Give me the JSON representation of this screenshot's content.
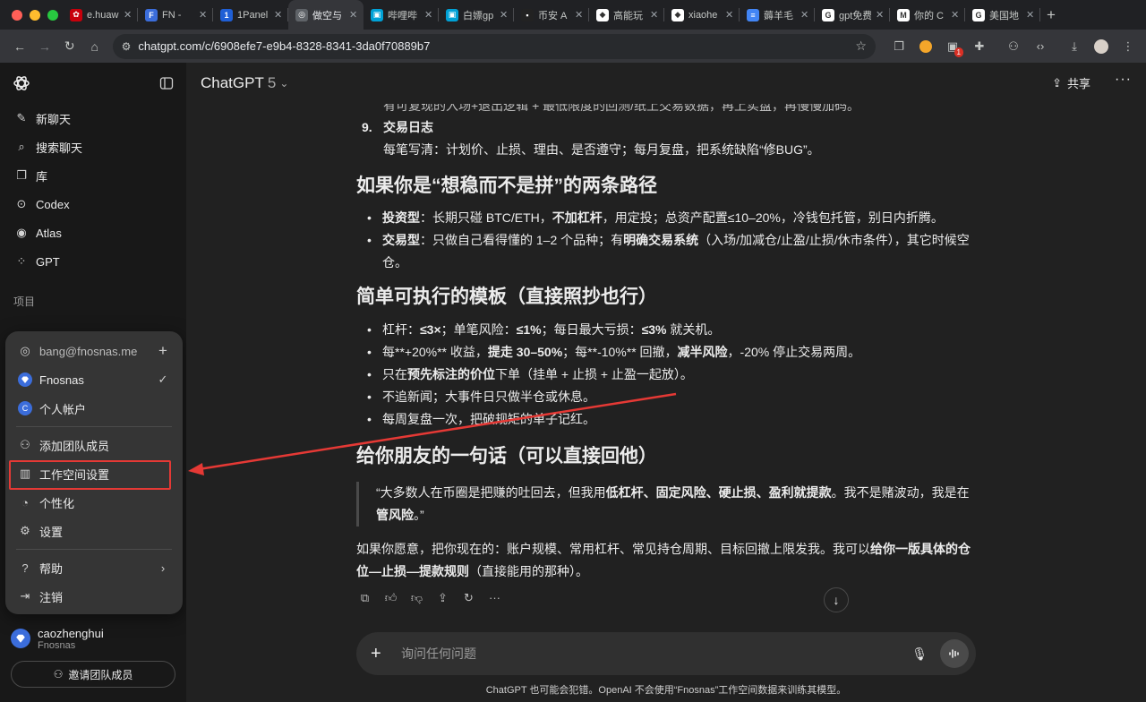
{
  "browser": {
    "traffic_colors": [
      "#ff5f57",
      "#febc2e",
      "#28c840"
    ],
    "tabs": [
      {
        "title": "e.huaw",
        "fav_color": "#c7000b",
        "fav_text": "✿"
      },
      {
        "title": "FN - ",
        "fav_color": "#3b6ddb",
        "fav_text": "F"
      },
      {
        "title": "1Panel",
        "fav_color": "#1f5fd6",
        "fav_text": "1"
      },
      {
        "title": "做空与",
        "fav_color": "#5f6368",
        "fav_text": "◎",
        "active": true
      },
      {
        "title": "哔哩哔",
        "fav_color": "#00a1d6",
        "fav_text": "▣"
      },
      {
        "title": "白嫖gp",
        "fav_color": "#00a1d6",
        "fav_text": "▣"
      },
      {
        "title": "币安 A",
        "fav_color": "#222",
        "fav_text": "▪"
      },
      {
        "title": "高能玩",
        "fav_color": "#fff",
        "fav_text": "◆"
      },
      {
        "title": "xiaohe",
        "fav_color": "#fff",
        "fav_text": "◆"
      },
      {
        "title": "薅羊毛",
        "fav_color": "#4285f4",
        "fav_text": "≡"
      },
      {
        "title": "gpt免费",
        "fav_color": "#fff",
        "fav_text": "G"
      },
      {
        "title": "你的 C",
        "fav_color": "#fff",
        "fav_text": "M"
      },
      {
        "title": "美国地",
        "fav_color": "#fff",
        "fav_text": "G"
      }
    ],
    "new_tab": "+",
    "url": "chatgpt.com/c/6908efe7-e9b4-8328-8341-3da0f70889b7",
    "ext_badge": "1"
  },
  "sidebar": {
    "items": [
      {
        "label": "新聊天",
        "icon": "edit-icon"
      },
      {
        "label": "搜索聊天",
        "icon": "search-icon"
      },
      {
        "label": "库",
        "icon": "library-icon"
      },
      {
        "label": "Codex",
        "icon": "codex-icon"
      },
      {
        "label": "Atlas",
        "icon": "compass-icon"
      },
      {
        "label": "GPT",
        "icon": "grid-icon"
      }
    ],
    "section_label": "项目",
    "user": {
      "name": "caozhenghui",
      "org": "Fnosnas"
    },
    "invite_label": "邀请团队成员"
  },
  "popup": {
    "email": "bang@fnosnas.me",
    "workspaces": [
      {
        "label": "Fnosnas",
        "selected": true
      },
      {
        "label": "个人帐户",
        "avatar": "C"
      }
    ],
    "menu1": [
      {
        "label": "添加团队成员",
        "icon": "add-user-icon"
      },
      {
        "label": "工作空间设置",
        "icon": "workspace-icon"
      },
      {
        "label": "个性化",
        "icon": "personalize-icon"
      },
      {
        "label": "设置",
        "icon": "gear-icon"
      }
    ],
    "menu2": [
      {
        "label": "帮助",
        "icon": "help-icon"
      },
      {
        "label": "注销",
        "icon": "logout-icon"
      }
    ]
  },
  "header": {
    "model_name": "ChatGPT",
    "model_version": "5",
    "share_label": "共享"
  },
  "conversation": {
    "clipped_line": "有可复现的入场+退出逻辑 + 最低限度的回测/纸上交易数据，再上实盘，再慢慢加码。",
    "item9": {
      "num": "9.",
      "title": "交易日志",
      "desc": "每笔写清：计划价、止损、理由、是否遵守；每月复盘，把系统缺陷“修BUG”。"
    },
    "h_paths": "如果你是“想稳而不是拼”的两条路径",
    "paths": [
      {
        "b": "投资型",
        "t1": "：长期只碰 BTC/ETH，",
        "b2": "不加杠杆",
        "t2": "，用定投；总资产配置≤10–20%，冷钱包托管，别日内折腾。"
      },
      {
        "b": "交易型",
        "t1": "：只做自己看得懂的 1–2 个品种；有",
        "b2": "明确交易系统",
        "t2": "（入场/加减仓/止盈/止损/休市条件），其它时候空仓。"
      }
    ],
    "h_template": "简单可执行的模板（直接照抄也行）",
    "template": {
      "l1": {
        "a": "杠杆：",
        "b": "≤3×",
        "c": "；单笔风险：",
        "d": "≤1%",
        "e": "；每日最大亏损：",
        "f": "≤3%",
        "g": " 就关机。"
      },
      "l2": {
        "a": "每**+20%** 收益，",
        "b": "提走 30–50%",
        "c": "；每**-10%** 回撤，",
        "d": "减半风险",
        "e": "，-20% 停止交易两周。"
      },
      "l3": {
        "a": "只在",
        "b": "预先标注的价位",
        "c": "下单（挂单 + 止损 + 止盈一起放）。"
      },
      "l4": "不追新闻；大事件日只做半仓或休息。",
      "l5": "每周复盘一次，把破规矩的单子记红。"
    },
    "h_friend": "给你朋友的一句话（可以直接回他）",
    "quote": {
      "a": "“大多数人在币圈是把赚的吐回去，但我用",
      "b": "低杠杆、固定风险、硬止损、盈利就提款",
      "c": "。我不是赌波动，我是在",
      "d": "管风险",
      "e": "。”"
    },
    "closing": {
      "a": "如果你愿意，把你现在的：账户规模、常用杠杆、常见持仓周期、目标回撤上限发我。我可以",
      "b": "给你一版具体的仓位—止损—提款规则",
      "c": "（直接能用的那种）。"
    }
  },
  "composer": {
    "placeholder": "询问任何问题"
  },
  "footnote": "ChatGPT 也可能会犯错。OpenAI 不会使用“Fnosnas”工作空间数据来训练其模型。",
  "colors": {
    "highlight": "#e53935",
    "accent": "#3b6ddb"
  }
}
